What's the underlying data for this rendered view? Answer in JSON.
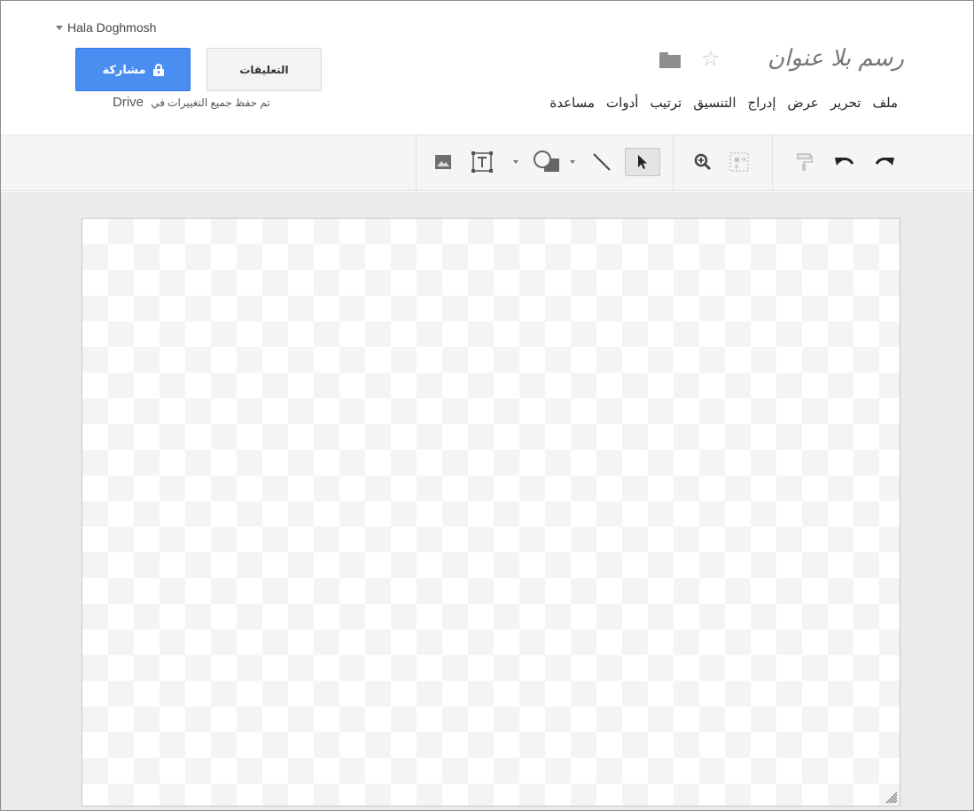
{
  "account": {
    "name": "Hala Doghmosh"
  },
  "buttons": {
    "share": "مشاركة",
    "comments": "التعليقات"
  },
  "document": {
    "title": "رسم بلا عنوان"
  },
  "menu": [
    "ملف",
    "تحرير",
    "عرض",
    "إدراج",
    "التنسيق",
    "ترتيب",
    "أدوات",
    "مساعدة"
  ],
  "save_status": {
    "text": "تم حفظ جميع التغييرات في",
    "service": "Drive"
  },
  "toolbar": {
    "tools": [
      "image-icon",
      "text-box-icon",
      "shape-icon",
      "line-icon",
      "select-pointer-icon",
      "zoom-icon",
      "fit-canvas-icon",
      "paint-format-icon",
      "undo-icon",
      "redo-icon"
    ],
    "active_tool": "select-pointer-icon"
  },
  "colors": {
    "share_button": "#4b8ef1",
    "toolbar_bg": "#f5f5f5",
    "workspace_bg": "#ebebeb"
  }
}
